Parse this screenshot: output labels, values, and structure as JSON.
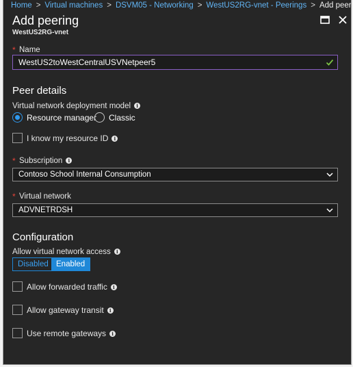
{
  "breadcrumb": {
    "items": [
      "Home",
      "Virtual machines",
      "DSVM05 - Networking",
      "WestUS2RG-vnet - Peerings"
    ],
    "current": "Add peering"
  },
  "blade": {
    "title": "Add peering",
    "subtitle": "WestUS2RG-vnet"
  },
  "name_field": {
    "label": "Name",
    "value": "WestUS2toWestCentralUSVNetpeer5"
  },
  "peer_details": {
    "heading": "Peer details",
    "deployment_model_label": "Virtual network deployment model",
    "options": [
      "Resource manager",
      "Classic"
    ],
    "selected": "Resource manager",
    "know_resource_id_label": "I know my resource ID",
    "subscription_label": "Subscription",
    "subscription_value": "Contoso School Internal Consumption",
    "vnet_label": "Virtual network",
    "vnet_value": "ADVNETRDSH"
  },
  "configuration": {
    "heading": "Configuration",
    "access_label": "Allow virtual network access",
    "access_options": [
      "Disabled",
      "Enabled"
    ],
    "access_selected": "Enabled",
    "forwarded_label": "Allow forwarded traffic",
    "gateway_transit_label": "Allow gateway transit",
    "remote_gateways_label": "Use remote gateways"
  },
  "colors": {
    "background": "#262626",
    "accent": "#1f88d8",
    "link": "#62b5f5",
    "required": "#e8443a",
    "valid": "#7ac143",
    "focus_border": "#8a5fc5"
  }
}
